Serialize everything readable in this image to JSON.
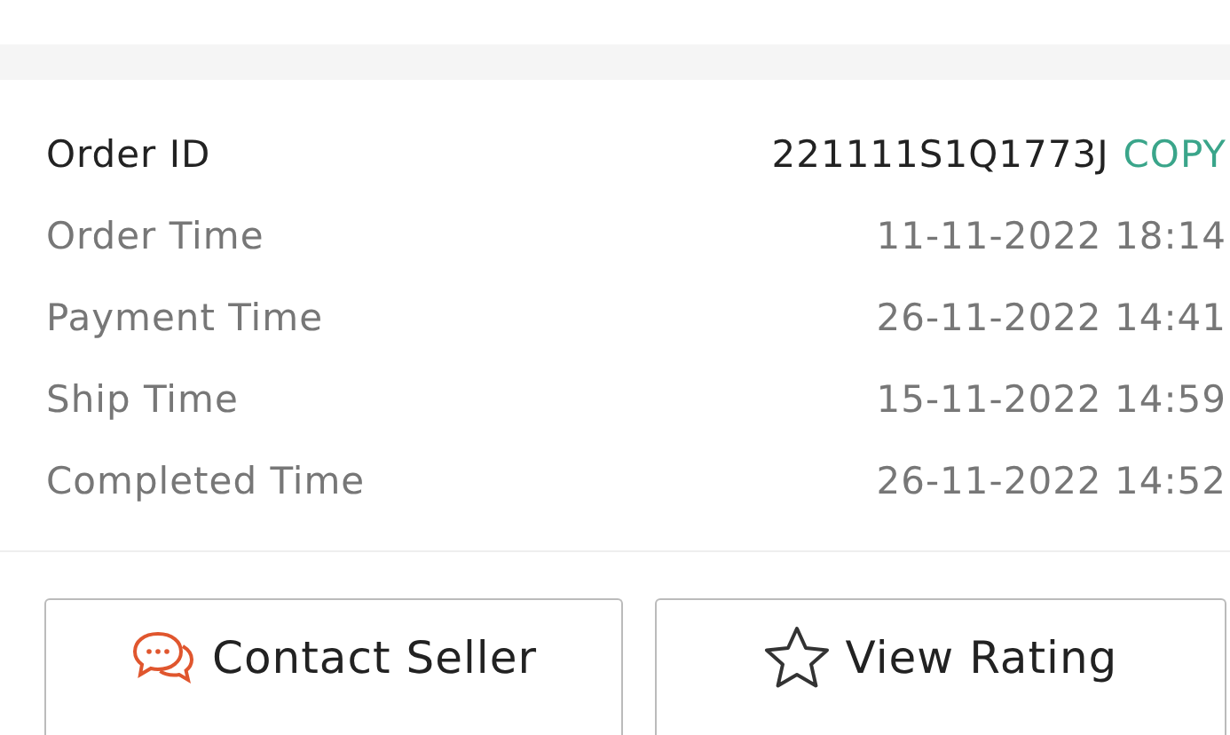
{
  "order_details": [
    {
      "label": "Order ID",
      "value": "221111S1Q1773J",
      "kind": "id",
      "action": "COPY"
    },
    {
      "label": "Order Time",
      "value": "11-11-2022 18:14",
      "kind": "time"
    },
    {
      "label": "Payment Time",
      "value": "26-11-2022 14:41",
      "kind": "time"
    },
    {
      "label": "Ship Time",
      "value": "15-11-2022 14:59",
      "kind": "time"
    },
    {
      "label": "Completed Time",
      "value": "26-11-2022 14:52",
      "kind": "time"
    }
  ],
  "buttons": [
    {
      "label": "Contact Seller",
      "kind": "chat"
    },
    {
      "label": "View Rating",
      "kind": "rating"
    }
  ]
}
